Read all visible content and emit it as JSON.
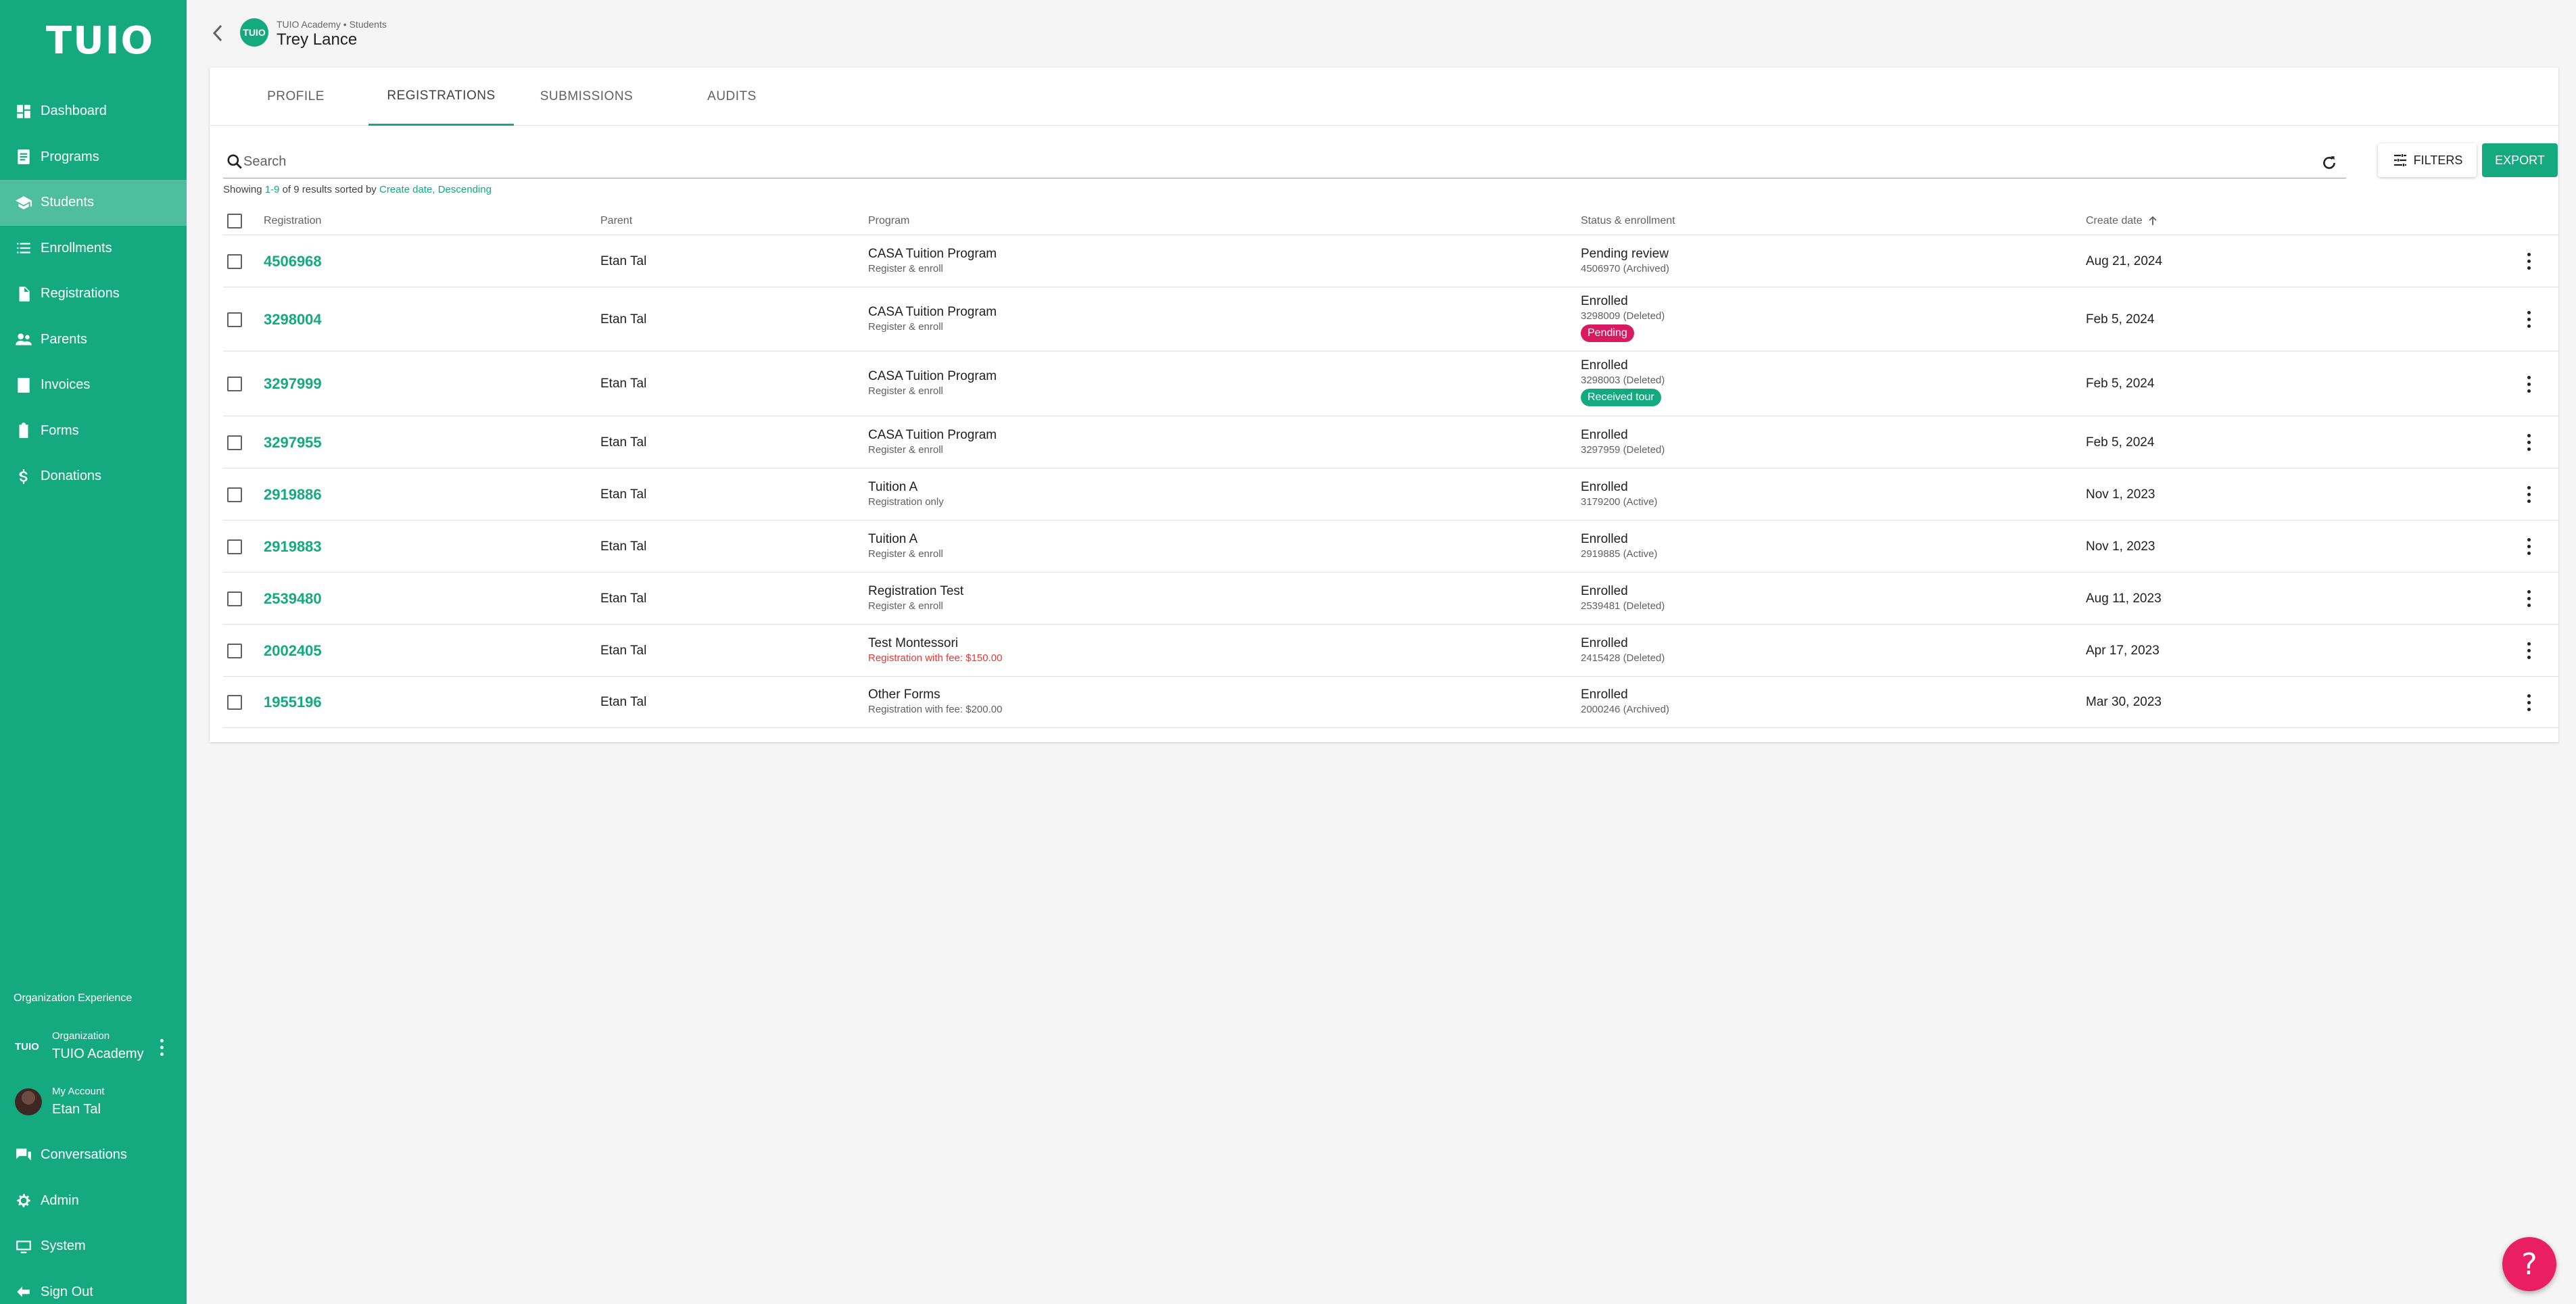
{
  "brand": {
    "logo": "TUIO",
    "accent": "#14a97e",
    "pink": "#e91e63"
  },
  "sidebar": {
    "items": [
      {
        "label": "Dashboard",
        "icon": "dashboard-icon",
        "active": false
      },
      {
        "label": "Programs",
        "icon": "programs-icon",
        "active": false
      },
      {
        "label": "Students",
        "icon": "students-icon",
        "active": true
      },
      {
        "label": "Enrollments",
        "icon": "list-icon",
        "active": false
      },
      {
        "label": "Registrations",
        "icon": "document-icon",
        "active": false
      },
      {
        "label": "Parents",
        "icon": "people-icon",
        "active": false
      },
      {
        "label": "Invoices",
        "icon": "invoice-icon",
        "active": false
      },
      {
        "label": "Forms",
        "icon": "clipboard-icon",
        "active": false
      },
      {
        "label": "Donations",
        "icon": "dollar-icon",
        "active": false
      }
    ],
    "org_experience": "Organization Experience",
    "org": {
      "logo": "TUIO",
      "label": "Organization",
      "name": "TUIO Academy"
    },
    "account": {
      "label": "My Account",
      "name": "Etan Tal"
    },
    "bottom_items": [
      {
        "label": "Conversations",
        "icon": "chat-icon"
      },
      {
        "label": "Admin",
        "icon": "gear-icon"
      },
      {
        "label": "System",
        "icon": "monitor-icon"
      },
      {
        "label": "Sign Out",
        "icon": "sign-out-icon"
      }
    ]
  },
  "header": {
    "avatar_text": "TUIO",
    "breadcrumb": "TUIO Academy • Students",
    "title": "Trey Lance"
  },
  "tabs": [
    {
      "label": "PROFILE",
      "active": false
    },
    {
      "label": "REGISTRATIONS",
      "active": true
    },
    {
      "label": "SUBMISSIONS",
      "active": false
    },
    {
      "label": "AUDITS",
      "active": false
    }
  ],
  "search": {
    "placeholder": "Search"
  },
  "toolbar": {
    "filters_label": "FILTERS",
    "export_label": "EXPORT"
  },
  "results": {
    "prefix": "Showing ",
    "range": "1-9",
    "middle": " of 9 results sorted by ",
    "sort_field": "Create date",
    "sep": ", ",
    "sort_dir": "Descending"
  },
  "table": {
    "columns": [
      "Registration",
      "Parent",
      "Program",
      "Status & enrollment",
      "Create date"
    ],
    "rows": [
      {
        "id": "4506968",
        "parent": "Etan Tal",
        "program": "CASA Tuition Program",
        "program_sub": "Register & enroll",
        "program_sub_red": false,
        "status": "Pending review",
        "status_sub": "4506970 (Archived)",
        "badge": null,
        "date": "Aug 21, 2024"
      },
      {
        "id": "3298004",
        "parent": "Etan Tal",
        "program": "CASA Tuition Program",
        "program_sub": "Register & enroll",
        "program_sub_red": false,
        "status": "Enrolled",
        "status_sub": "3298009 (Deleted)",
        "badge": {
          "text": "Pending",
          "color": "#d81b60"
        },
        "date": "Feb 5, 2024"
      },
      {
        "id": "3297999",
        "parent": "Etan Tal",
        "program": "CASA Tuition Program",
        "program_sub": "Register & enroll",
        "program_sub_red": false,
        "status": "Enrolled",
        "status_sub": "3298003 (Deleted)",
        "badge": {
          "text": "Received tour",
          "color": "#14a97e"
        },
        "date": "Feb 5, 2024"
      },
      {
        "id": "3297955",
        "parent": "Etan Tal",
        "program": "CASA Tuition Program",
        "program_sub": "Register & enroll",
        "program_sub_red": false,
        "status": "Enrolled",
        "status_sub": "3297959 (Deleted)",
        "badge": null,
        "date": "Feb 5, 2024"
      },
      {
        "id": "2919886",
        "parent": "Etan Tal",
        "program": "Tuition A",
        "program_sub": "Registration only",
        "program_sub_red": false,
        "status": "Enrolled",
        "status_sub": "3179200 (Active)",
        "badge": null,
        "date": "Nov 1, 2023"
      },
      {
        "id": "2919883",
        "parent": "Etan Tal",
        "program": "Tuition A",
        "program_sub": "Register & enroll",
        "program_sub_red": false,
        "status": "Enrolled",
        "status_sub": "2919885 (Active)",
        "badge": null,
        "date": "Nov 1, 2023"
      },
      {
        "id": "2539480",
        "parent": "Etan Tal",
        "program": "Registration Test",
        "program_sub": "Register & enroll",
        "program_sub_red": false,
        "status": "Enrolled",
        "status_sub": "2539481 (Deleted)",
        "badge": null,
        "date": "Aug 11, 2023"
      },
      {
        "id": "2002405",
        "parent": "Etan Tal",
        "program": "Test Montessori",
        "program_sub": "Registration with fee: $150.00",
        "program_sub_red": true,
        "status": "Enrolled",
        "status_sub": "2415428 (Deleted)",
        "badge": null,
        "date": "Apr 17, 2023"
      },
      {
        "id": "1955196",
        "parent": "Etan Tal",
        "program": "Other Forms",
        "program_sub": "Registration with fee: $200.00",
        "program_sub_red": false,
        "status": "Enrolled",
        "status_sub": "2000246 (Archived)",
        "badge": null,
        "date": "Mar 30, 2023"
      }
    ]
  },
  "help": {
    "label": "?"
  }
}
